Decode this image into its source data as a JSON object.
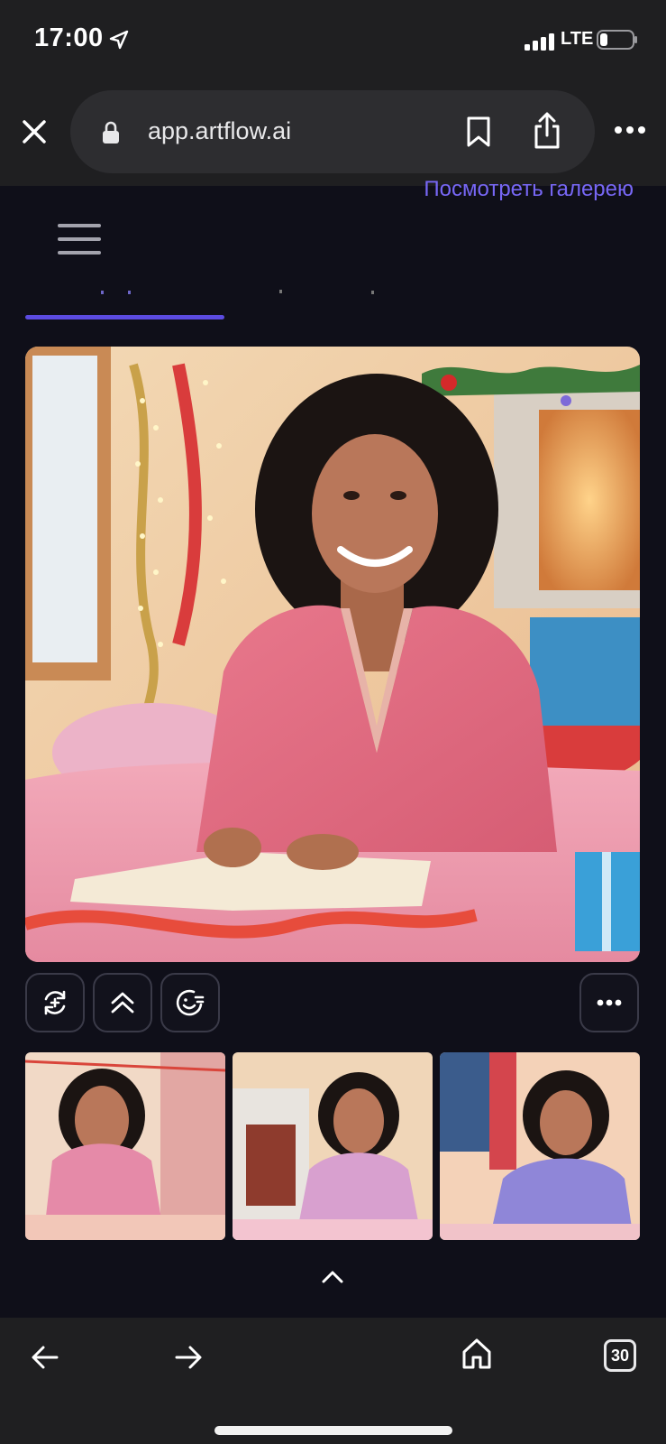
{
  "status_bar": {
    "time": "17:00",
    "network": "LTE",
    "icons": [
      "location-arrow-icon",
      "signal-bars-icon",
      "battery-icon"
    ]
  },
  "browser": {
    "url": "app.artflow.ai",
    "icons": [
      "close-icon",
      "lock-icon",
      "bookmark-icon",
      "share-icon",
      "more-icon"
    ]
  },
  "page": {
    "gallery_link": "Посмотреть галерею",
    "menu_icon": "hamburger-icon",
    "main_image_description_icon": "generated-image",
    "actions": [
      "regenerate-icon",
      "upscale-icon",
      "face-edit-icon",
      "more-icon"
    ],
    "thumbnails_count": 3,
    "collapse_icon": "chevron-up-icon"
  },
  "bottom_bar": {
    "tabs_count": "30",
    "icons": [
      "back-arrow-icon",
      "forward-arrow-icon",
      "home-icon",
      "tabs-icon"
    ]
  },
  "colors": {
    "accent": "#5b4be0",
    "link": "#7767f5",
    "background": "#0f0f19",
    "chrome": "#1f1f21"
  }
}
